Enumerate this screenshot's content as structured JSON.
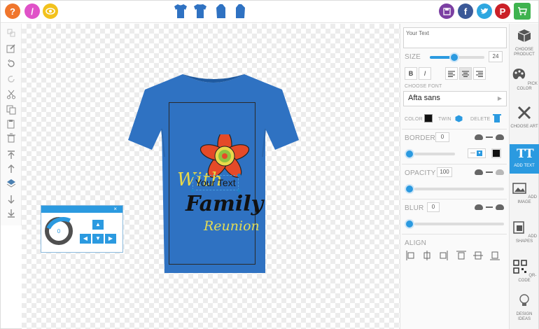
{
  "topbar": {
    "help_icon": "question-icon",
    "help_glyph": "?",
    "edit_icon": "pencil-icon",
    "edit_glyph": "/",
    "preview_icon": "eye-icon",
    "views": [
      "front-view",
      "back-view",
      "left-sleeve-view",
      "right-sleeve-view"
    ],
    "social": [
      "save-icon",
      "facebook-icon",
      "twitter-icon",
      "pinterest-icon",
      "cart-icon"
    ],
    "social_glyphs": {
      "facebook": "f",
      "pinterest": "P"
    }
  },
  "design": {
    "line1": "With",
    "line2": "Your Text",
    "line3": "Family",
    "line4": "Reunion",
    "shirt_color": "#2f72c2"
  },
  "dial": {
    "close": "×",
    "value": "0",
    "arrows": {
      "up": "▲",
      "left": "◀",
      "down": "▼",
      "right": "▶"
    }
  },
  "panel": {
    "text_value": "Your Text",
    "size_label": "SIZE",
    "size_value": "24",
    "bold": "B",
    "italic": "I",
    "choose_font_label": "CHOOSE FONT",
    "font_name": "Afta sans",
    "color_label": "COLOR",
    "twin_label": "TWIN",
    "delete_label": "DELETE",
    "border_label": "BORDER",
    "border_value": "0",
    "opacity_label": "OPACITY",
    "opacity_value": "100",
    "blur_label": "BLUR",
    "blur_value": "0",
    "align_label": "ALIGN",
    "accent": "#2b9ae0"
  },
  "nav": {
    "choose_product": "CHOOSE PRODUCT",
    "pick_color": "PICK COLOR",
    "choose_art": "CHOOSE ART",
    "add_text_glyph": "Tt",
    "add_text": "ADD TEXT",
    "add_image": "ADD IMAGE",
    "add_shapes": "ADD SHAPES",
    "qr_code": "QR-CODE",
    "design_ideas": "DESIGN IDEAS"
  }
}
